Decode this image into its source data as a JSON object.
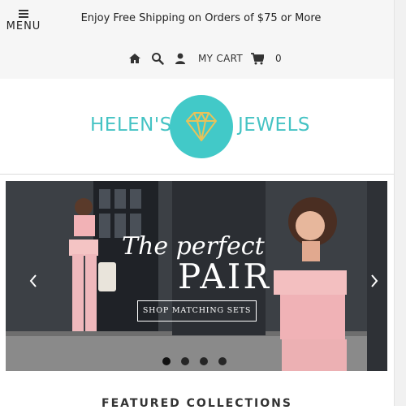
{
  "header": {
    "menu_label": "MENU",
    "promo_text": "Enjoy Free Shipping on Orders of $75 or More",
    "cart_label": "MY CART",
    "cart_count": "0"
  },
  "logo": {
    "left_text": "HELEN'S",
    "right_text": "JEWELS"
  },
  "hero": {
    "script_text": "The perfect",
    "title": "PAIR",
    "button_label": "SHOP MATCHING SETS",
    "slide_count": 4,
    "active_slide": 1
  },
  "featured": {
    "title": "FEATURED COLLECTIONS"
  },
  "icons": {
    "menu": "hamburger-icon",
    "home": "home-icon",
    "search": "search-icon",
    "account": "user-icon",
    "cart": "cart-icon",
    "prev": "chevron-left-icon",
    "next": "chevron-right-icon",
    "logo_mark": "diamond-icon"
  },
  "colors": {
    "brand_teal": "#45c3c4",
    "topbar_bg": "#f6f6f6",
    "text_dark": "#222222"
  }
}
